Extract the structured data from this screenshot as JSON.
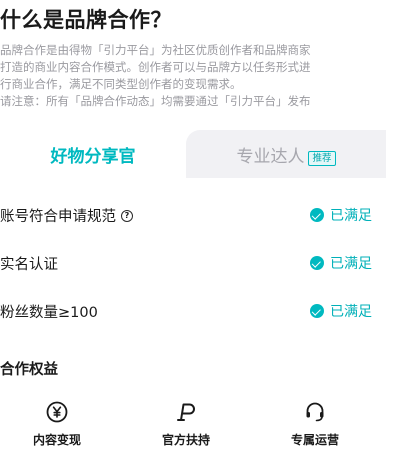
{
  "page": {
    "title": "什么是品牌合作？",
    "description": [
      "品牌合作是由得物「引力平台」为社区优质创作者和品牌商家",
      "打造的商业内容合作模式。创作者可以与品牌方以任务形式进",
      "行商业合作，满足不同类型创作者的变现需求。",
      "请注意：所有「品牌合作动态」均需要通过「引力平台」发布"
    ]
  },
  "tabs": {
    "active": {
      "label": "好物分享官"
    },
    "inactive": {
      "label": "专业达人",
      "badge": "推荐"
    }
  },
  "requirements": [
    {
      "label": "账号符合申请规范",
      "status": "已满足",
      "has_help": true
    },
    {
      "label": "实名认证",
      "status": "已满足",
      "has_help": false
    },
    {
      "label": "粉丝数量≥100",
      "status": "已满足",
      "has_help": false
    }
  ],
  "benefits_section": {
    "title": "合作权益",
    "items": [
      {
        "label": "内容变现",
        "icon": "yen-coin-icon"
      },
      {
        "label": "官方扶持",
        "icon": "support-p-icon"
      },
      {
        "label": "专属运营",
        "icon": "headset-icon"
      }
    ]
  },
  "colors": {
    "accent": "#00b9c0",
    "muted_text": "#9a9aa0",
    "inactive_tab_bg": "#f1f1f4"
  }
}
